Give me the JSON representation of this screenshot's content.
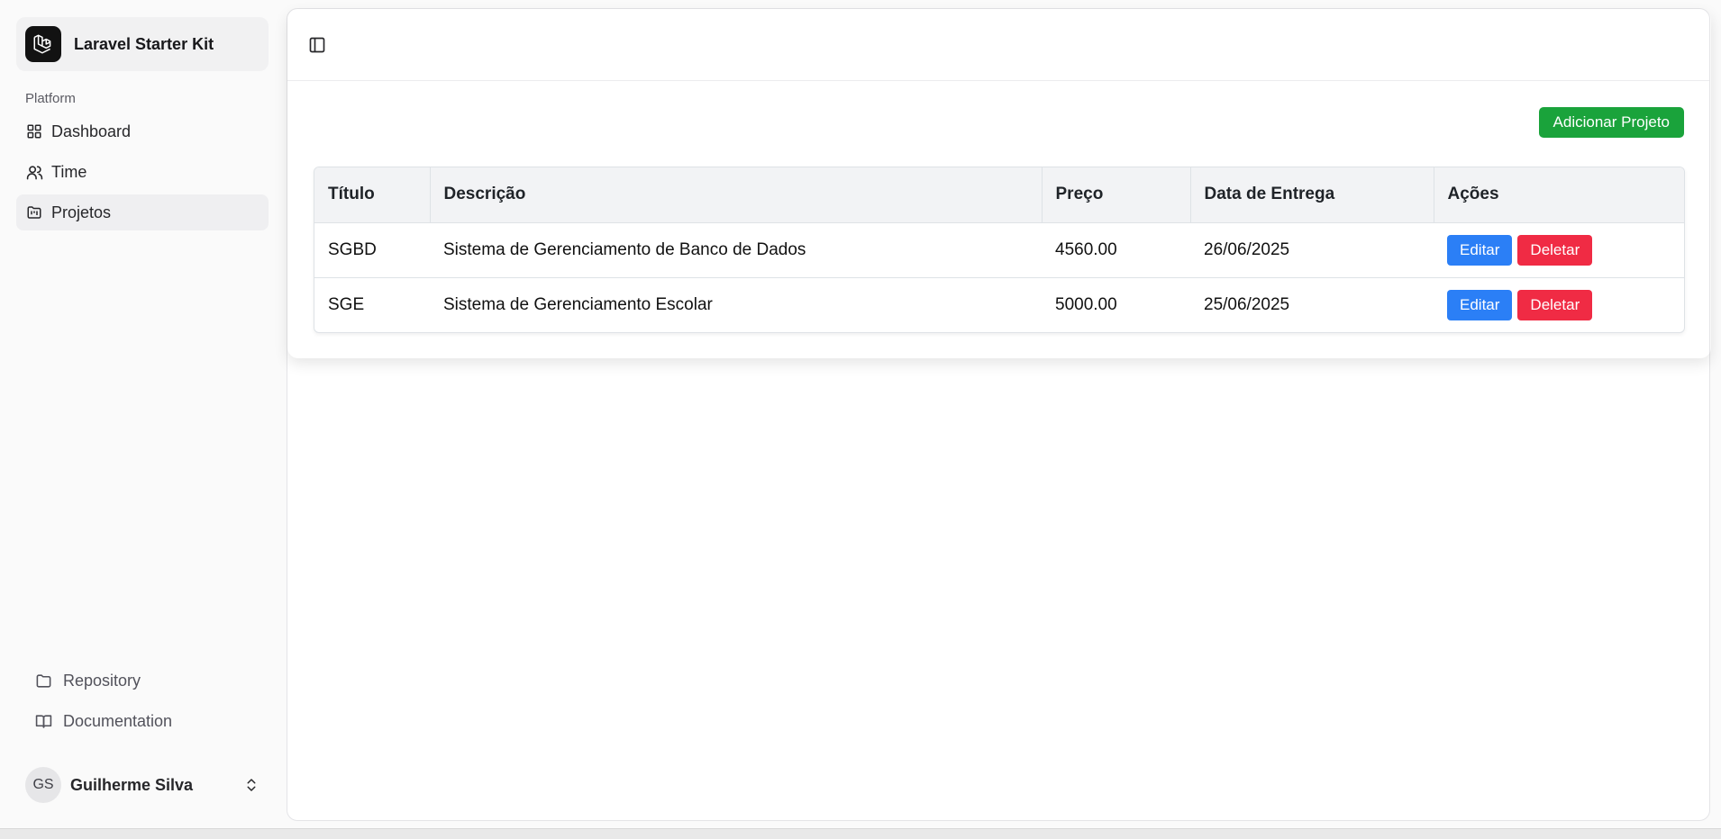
{
  "sidebar": {
    "brand": "Laravel Starter Kit",
    "group_label": "Platform",
    "items": [
      {
        "label": "Dashboard",
        "icon": "layout-grid-icon"
      },
      {
        "label": "Time",
        "icon": "users-icon"
      },
      {
        "label": "Projetos",
        "icon": "folder-kanban-icon"
      }
    ],
    "bottom_links": [
      {
        "label": "Repository",
        "icon": "folder-icon"
      },
      {
        "label": "Documentation",
        "icon": "book-open-icon"
      }
    ],
    "user": {
      "initials": "GS",
      "name": "Guilherme Silva"
    }
  },
  "main": {
    "add_button": "Adicionar Projeto",
    "table": {
      "headers": [
        "Título",
        "Descrição",
        "Preço",
        "Data de Entrega",
        "Ações"
      ],
      "rows": [
        {
          "titulo": "SGBD",
          "descricao": "Sistema de Gerenciamento de Banco de Dados",
          "preco": "4560.00",
          "data": "26/06/2025"
        },
        {
          "titulo": "SGE",
          "descricao": "Sistema de Gerenciamento Escolar",
          "preco": "5000.00",
          "data": "25/06/2025"
        }
      ],
      "edit_label": "Editar",
      "delete_label": "Deletar"
    }
  },
  "colors": {
    "primary_green": "#1aa33b",
    "edit_blue": "#2b7ff6",
    "delete_red": "#f02b44"
  }
}
